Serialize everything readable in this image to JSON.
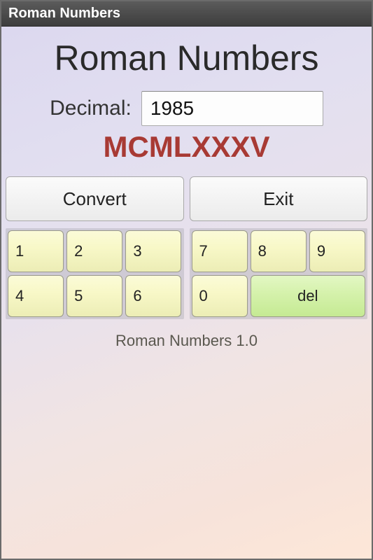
{
  "titlebar": {
    "title": "Roman Numbers"
  },
  "heading": "Roman Numbers",
  "input": {
    "label": "Decimal:",
    "value": "1985"
  },
  "output": {
    "roman": "MCMLXXXV"
  },
  "actions": {
    "convert": "Convert",
    "exit": "Exit"
  },
  "keypad": {
    "left": [
      "1",
      "2",
      "3",
      "4",
      "5",
      "6"
    ],
    "right": [
      "7",
      "8",
      "9",
      "0"
    ],
    "del": "del"
  },
  "footer": {
    "version": "Roman Numbers 1.0"
  }
}
